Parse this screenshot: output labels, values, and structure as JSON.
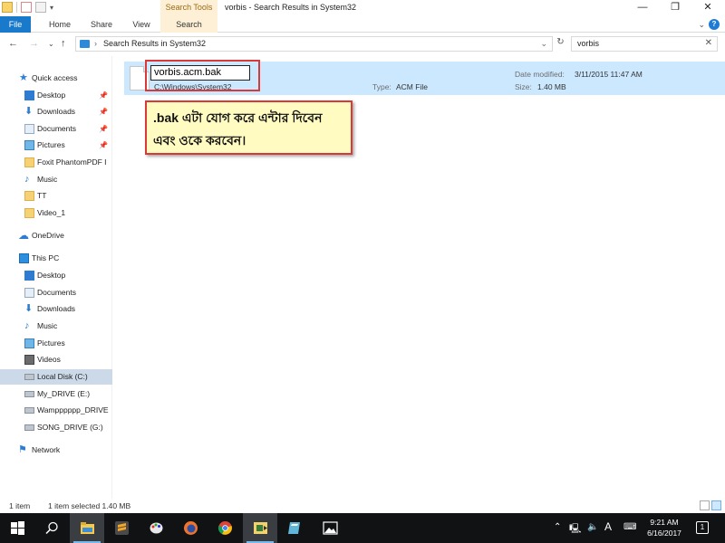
{
  "window": {
    "title": "vorbis - Search Results in System32",
    "contextual_tab": "Search Tools",
    "controls": {
      "minimize": "—",
      "maximize": "❐",
      "close": "✕"
    }
  },
  "ribbon": {
    "tabs": [
      "File",
      "Home",
      "Share",
      "View",
      "Search"
    ]
  },
  "address": {
    "path": "Search Results in System32",
    "search_value": "vorbis"
  },
  "nav": {
    "quick_access": "Quick access",
    "quick_items": [
      "Desktop",
      "Downloads",
      "Documents",
      "Pictures",
      "Foxit PhantomPDF I",
      "Music",
      "TT",
      "Video_1"
    ],
    "onedrive": "OneDrive",
    "this_pc": "This PC",
    "pc_items": [
      "Desktop",
      "Documents",
      "Downloads",
      "Music",
      "Pictures",
      "Videos",
      "Local Disk (C:)",
      "My_DRIVE (E:)",
      "Wampppppp_DRIVE",
      "SONG_DRIVE (G:)"
    ],
    "network": "Network"
  },
  "file": {
    "rename_value": "vorbis.acm.bak",
    "location": "C:\\Windows\\System32",
    "type_label": "Type:",
    "type_value": "ACM File",
    "date_label": "Date modified:",
    "date_value": "3/11/2015 11:47 AM",
    "size_label": "Size:",
    "size_value": "1.40 MB"
  },
  "callout": {
    "line1": ".bak এটা যোগ করে এন্টার দিবেন",
    "line2": "এবং ওকে করবেন।"
  },
  "status": {
    "items": "1 item",
    "selected": "1 item selected  1.40 MB"
  },
  "taskbar": {
    "time": "9:21 AM",
    "date": "6/16/2017",
    "lang": "A"
  },
  "colors": {
    "file_tab": "#1979ca",
    "selection": "#cce8ff",
    "callout_bg": "#fffbc1",
    "callout_border": "#d83a3a",
    "taskbar": "#101214"
  }
}
